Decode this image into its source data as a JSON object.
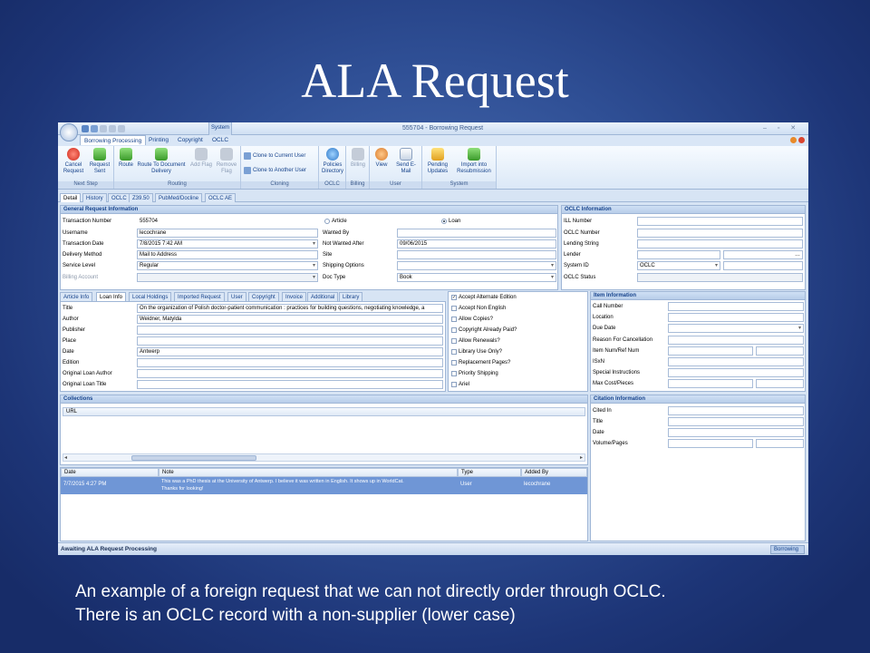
{
  "slide": {
    "title": "ALA Request",
    "caption_line1": "An example of a foreign request that we can not directly order through OCLC.",
    "caption_line2": "There is an OCLC record with a non-supplier (lower case)"
  },
  "app": {
    "window_title": "555704 - Borrowing Request",
    "system_label": "System",
    "ribbon_tabs": [
      "Borrowing Processing",
      "Printing",
      "Copyright",
      "OCLC"
    ],
    "groups": {
      "next_step": {
        "label": "Next Step",
        "cancel": "Cancel Request",
        "request_sent": "Request Sent"
      },
      "routing": {
        "label": "Routing",
        "route": "Route",
        "route_to_doc": "Route To Document Delivery",
        "add_flag": "Add Flag",
        "remove_flag": "Remove Flag"
      },
      "cloning": {
        "label": "Cloning",
        "clone_current": "Clone to Current User",
        "clone_another": "Clone to Another User"
      },
      "oclc": {
        "label": "OCLC",
        "policies": "Policies Directory"
      },
      "billing": {
        "label": "Billing",
        "billing": "Billing"
      },
      "user": {
        "label": "User",
        "view": "View",
        "send_email": "Send E-Mail"
      },
      "system": {
        "label": "System",
        "pending_updates": "Pending Updates",
        "import_resub": "Import into Resubmission"
      }
    },
    "detail_tabs": [
      "Detail",
      "History",
      "OCLC",
      "Z39.50",
      "PubMed/Docline",
      "OCLC AE"
    ],
    "general": {
      "header": "General Request Information",
      "transaction_number_label": "Transaction Number",
      "transaction_number": "555704",
      "username_label": "Username",
      "username": "lecochrane",
      "transaction_date_label": "Transaction Date",
      "transaction_date": "7/8/2015 7:42 AM",
      "delivery_method_label": "Delivery Method",
      "delivery_method": "Mail to Address",
      "service_level_label": "Service Level",
      "service_level": "Regular",
      "billing_account_label": "Billing Account",
      "article_label": "Article",
      "loan_label": "Loan",
      "wanted_by_label": "Wanted By",
      "not_wanted_after_label": "Not Wanted After",
      "not_wanted_after": "09/06/2015",
      "site_label": "Site",
      "shipping_options_label": "Shipping Options",
      "doc_type_label": "Doc Type",
      "doc_type": "Book"
    },
    "oclc_info": {
      "header": "OCLC Information",
      "ill_number": "ILL Number",
      "oclc_number": "OCLC Number",
      "lending_string": "Lending String",
      "lender": "Lender",
      "system_id": "System ID",
      "system_id_value": "OCLC",
      "oclc_status": "OCLC Status"
    },
    "sub_tabs": [
      "Article Info",
      "Loan Info",
      "Local Holdings",
      "Imported Request",
      "User",
      "Copyright",
      "Invoice",
      "Additional",
      "Library"
    ],
    "loan": {
      "title_label": "Title",
      "title": "On the organization of Polish doctor-patient communication : practices for building questions, negotiating knowledge, a",
      "author_label": "Author",
      "author": "Weidner, Matylda",
      "publisher_label": "Publisher",
      "place_label": "Place",
      "date_label": "Date",
      "date": "Antwerp",
      "edition_label": "Edition",
      "orig_author_label": "Original Loan Author",
      "orig_title_label": "Original Loan Title"
    },
    "checks": [
      {
        "label": "Accept Alternate Edition",
        "checked": true
      },
      {
        "label": "Accept Non English",
        "checked": false
      },
      {
        "label": "Allow Copies?",
        "checked": false
      },
      {
        "label": "Copyright Already Paid?",
        "checked": false
      },
      {
        "label": "Allow Renewals?",
        "checked": false
      },
      {
        "label": "Library Use Only?",
        "checked": false
      },
      {
        "label": "Replacement Pages?",
        "checked": false
      },
      {
        "label": "Priority Shipping",
        "checked": false
      },
      {
        "label": "Ariel",
        "checked": false
      }
    ],
    "item_info": {
      "header": "Item Information",
      "call_number": "Call Number",
      "location": "Location",
      "due_date": "Due Date",
      "reason_cancel": "Reason For Cancellation",
      "item_num": "Item Num/Ref Num",
      "issn": "ISxN",
      "special": "Special Instructions",
      "max_cost": "Max Cost/Pieces"
    },
    "collections": {
      "header": "Collections",
      "url_col": "URL"
    },
    "citation": {
      "header": "Citation Information",
      "cited_in": "Cited In",
      "title": "Title",
      "date": "Date",
      "volume": "Volume/Pages"
    },
    "notes": {
      "columns": [
        "Date",
        "Note",
        "Type",
        "Added By"
      ],
      "row": {
        "date": "7/7/2015 4:27 PM",
        "note_line1": "This was a PhD thesis at the University of Antwerp. I believe it was written in English. It shows up in WorldCat.",
        "note_line2": "Thanks for looking!",
        "type": "User",
        "added_by": "lecochrane"
      }
    },
    "status_text": "Awaiting ALA Request Processing",
    "status_right": "Borrowing"
  },
  "colors": {
    "accent": "#15428b",
    "selected_row": "#6f96d6"
  }
}
